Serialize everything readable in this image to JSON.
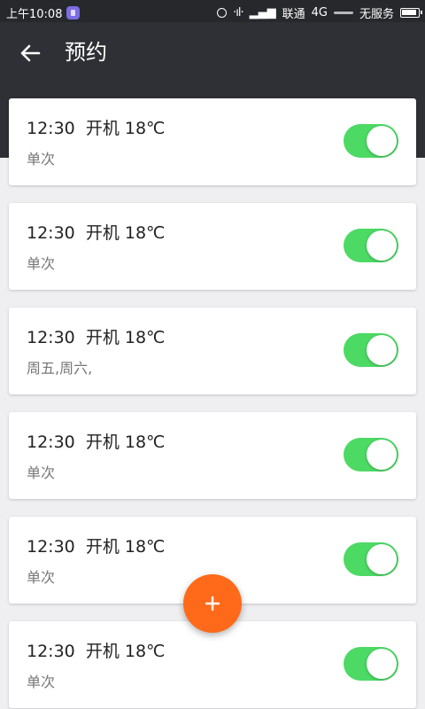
{
  "status_bar": {
    "time": "上午10:08",
    "carrier": "联通",
    "network": "4G",
    "service": "无服务"
  },
  "toolbar": {
    "title": "预约"
  },
  "schedules": [
    {
      "title": "12:30  开机 18℃",
      "repeat": "单次",
      "enabled": true
    },
    {
      "title": "12:30  开机 18℃",
      "repeat": "单次",
      "enabled": true
    },
    {
      "title": "12:30  开机 18℃",
      "repeat": "周五,周六,",
      "enabled": true
    },
    {
      "title": "12:30  开机 18℃",
      "repeat": "单次",
      "enabled": true
    },
    {
      "title": "12:30  开机 18℃",
      "repeat": "单次",
      "enabled": true
    },
    {
      "title": "12:30  开机 18℃",
      "repeat": "单次",
      "enabled": true
    }
  ],
  "colors": {
    "header": "#2f3035",
    "toggle_on": "#4cd964",
    "fab": "#ff6a1a"
  },
  "icons": {
    "back": "arrow-left-icon",
    "fab": "plus-icon"
  }
}
